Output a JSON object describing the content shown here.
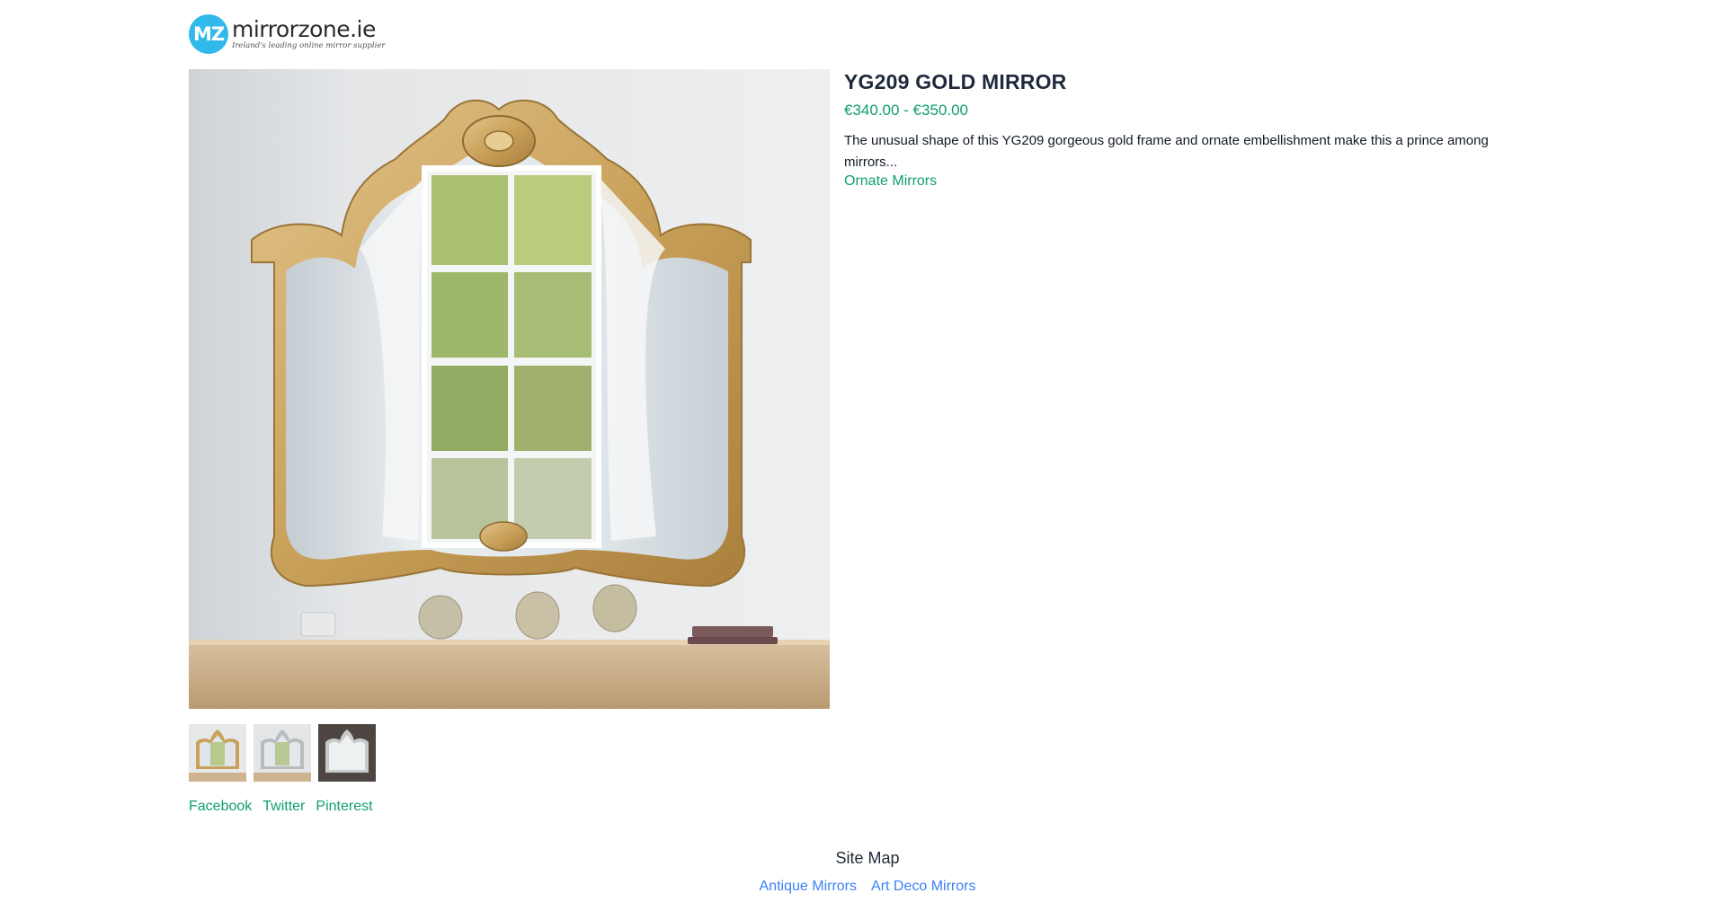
{
  "header": {
    "logo_initials": "MZ",
    "logo_name": "mirrorzone.ie",
    "logo_tagline": "Ireland's leading online mirror supplier"
  },
  "product": {
    "title": "YG209 GOLD MIRROR",
    "price_range": "€340.00 - €350.00",
    "description": "The unusual shape of this YG209 gorgeous gold frame and ornate embellishment make this a prince among mirrors...",
    "category_link": "Ornate Mirrors"
  },
  "thumbnails": [
    {
      "label": "gold-mirror-thumbnail"
    },
    {
      "label": "silver-mirror-thumbnail"
    },
    {
      "label": "dark-mirror-thumbnail"
    }
  ],
  "social": {
    "facebook": "Facebook",
    "twitter": "Twitter",
    "pinterest": "Pinterest"
  },
  "footer": {
    "sitemap_title": "Site Map",
    "links": [
      "Antique Mirrors",
      "Art Deco Mirrors"
    ]
  },
  "colors": {
    "accent_green": "#0f9d74",
    "link_blue": "#3b82f6",
    "logo_blue": "#32b9ec",
    "frame_gold": "#c9a15a"
  }
}
